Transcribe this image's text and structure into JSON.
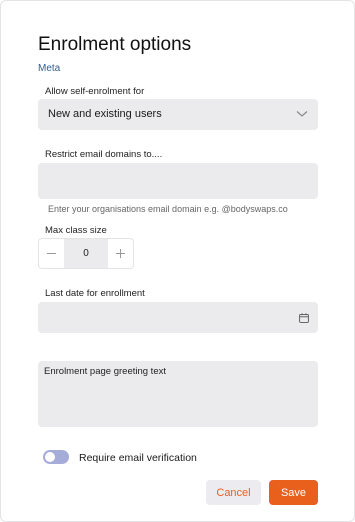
{
  "dialog": {
    "title": "Enrolment options",
    "meta_link": "Meta"
  },
  "self_enrolment": {
    "label": "Allow self-enrolment for",
    "selected": "New and existing users",
    "icon": "chevron-down-icon"
  },
  "email_domains": {
    "label": "Restrict email domains to....",
    "value": "",
    "helper": "Enter your organisations email domain e.g. @bodyswaps.co"
  },
  "max_class_size": {
    "label": "Max class size",
    "value": "0",
    "decrement_icon": "minus-icon",
    "increment_icon": "plus-icon"
  },
  "last_date": {
    "label": "Last date for enrollment",
    "value": "",
    "icon": "calendar-icon"
  },
  "greeting": {
    "label": "Enrolment page greeting text",
    "value": ""
  },
  "email_verification": {
    "label": "Require email verification",
    "enabled": false
  },
  "actions": {
    "cancel_label": "Cancel",
    "save_label": "Save"
  },
  "colors": {
    "accent": "#e8601c",
    "link": "#2f5f8f",
    "field_bg": "#ebebed",
    "toggle_off": "#a6acd8"
  }
}
